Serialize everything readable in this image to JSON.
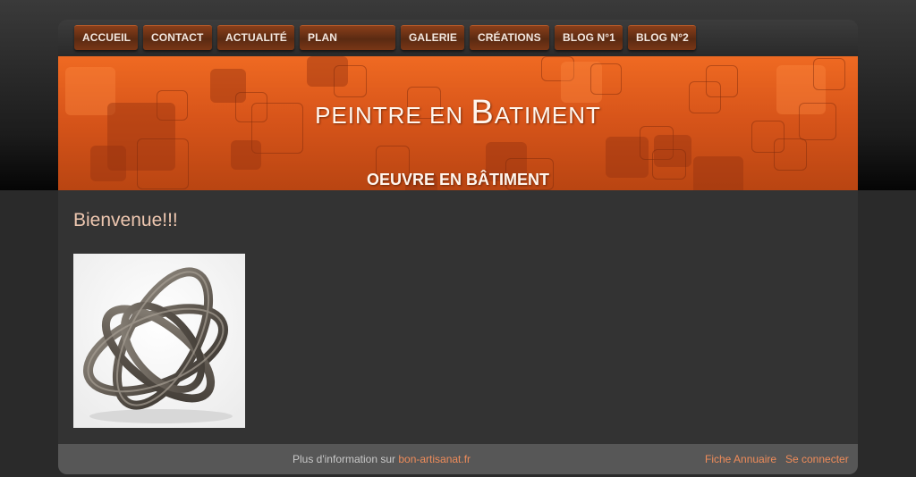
{
  "nav": {
    "items": [
      {
        "label": "ACCUEIL"
      },
      {
        "label": "CONTACT"
      },
      {
        "label": "ACTUALITÉ"
      },
      {
        "label": "PLAN"
      },
      {
        "label": "GALERIE"
      },
      {
        "label": "CRÉATIONS"
      },
      {
        "label": "BLOG N°1"
      },
      {
        "label": "BLOG N°2"
      }
    ]
  },
  "banner": {
    "title_part1": "PEINTRE EN ",
    "title_big": "B",
    "title_part2": "ATIMENT",
    "subtitle": "OEUVRE EN BÂTIMENT"
  },
  "main": {
    "heading": "Bienvenue!!!"
  },
  "footer": {
    "info_text": "Plus d'information sur ",
    "info_link": "bon-artisanat.fr",
    "fiche_link": "Fiche Annuaire",
    "login_link": "Se connecter"
  },
  "colors": {
    "accent": "#d8551a",
    "link": "#ef8c5a",
    "heading": "#eec7b0"
  }
}
